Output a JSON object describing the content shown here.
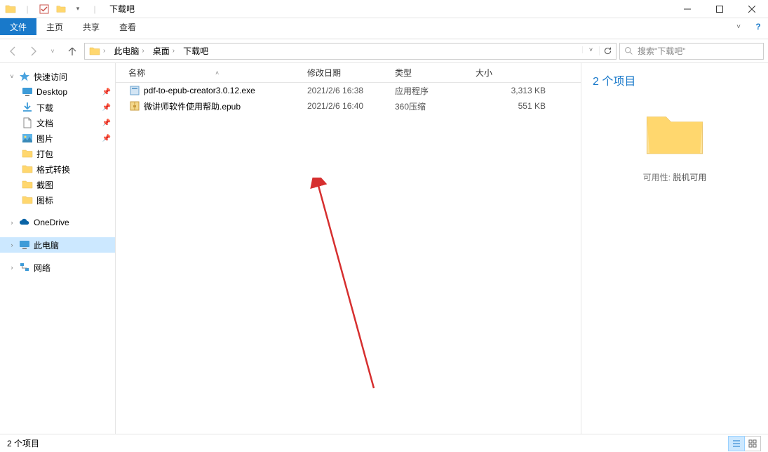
{
  "window": {
    "title": "下载吧"
  },
  "ribbon": {
    "file": "文件",
    "home": "主页",
    "share": "共享",
    "view": "查看"
  },
  "breadcrumb": {
    "pc": "此电脑",
    "desktop": "桌面",
    "folder": "下载吧"
  },
  "search": {
    "placeholder": "搜索\"下载吧\""
  },
  "sidebar": {
    "quick_access": "快速访问",
    "items": [
      {
        "label": "Desktop",
        "icon": "desktop"
      },
      {
        "label": "下载",
        "icon": "downloads"
      },
      {
        "label": "文档",
        "icon": "documents"
      },
      {
        "label": "图片",
        "icon": "pictures"
      },
      {
        "label": "打包",
        "icon": "folder"
      },
      {
        "label": "格式转换",
        "icon": "folder"
      },
      {
        "label": "截图",
        "icon": "folder"
      },
      {
        "label": "图标",
        "icon": "folder"
      }
    ],
    "onedrive": "OneDrive",
    "this_pc": "此电脑",
    "network": "网络"
  },
  "columns": {
    "name": "名称",
    "date": "修改日期",
    "type": "类型",
    "size": "大小"
  },
  "files": [
    {
      "name": "pdf-to-epub-creator3.0.12.exe",
      "date": "2021/2/6 16:38",
      "type": "应用程序",
      "size": "3,313 KB",
      "icon": "exe"
    },
    {
      "name": "微讲师软件使用帮助.epub",
      "date": "2021/2/6 16:40",
      "type": "360压缩",
      "size": "551 KB",
      "icon": "archive"
    }
  ],
  "preview": {
    "count_label": "2 个项目",
    "availability_label": "可用性:",
    "availability_value": "脱机可用"
  },
  "status": {
    "text": "2 个项目"
  }
}
